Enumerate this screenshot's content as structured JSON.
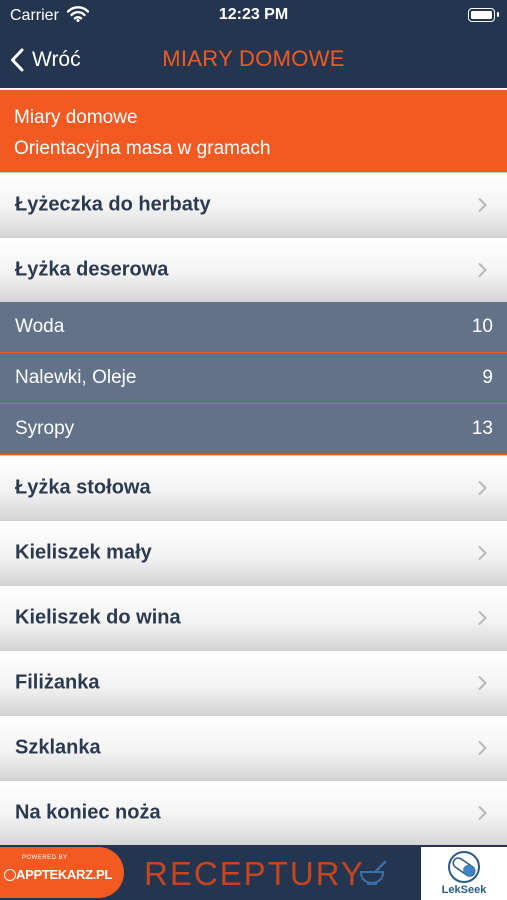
{
  "status_bar": {
    "carrier": "Carrier",
    "time": "12:23 PM",
    "icons": [
      "wifi-icon",
      "battery-icon"
    ]
  },
  "nav": {
    "back_label": "Wróć",
    "title": "MIARY DOMOWE"
  },
  "header": {
    "line1": "Miary domowe",
    "line2": "Orientacyjna masa w gramach"
  },
  "list": {
    "item_0": "Łyżeczka do herbaty",
    "item_1": "Łyżka deserowa",
    "expanded": [
      {
        "name": "Woda",
        "value": "10"
      },
      {
        "name": "Nalewki, Oleje",
        "value": "9"
      },
      {
        "name": "Syropy",
        "value": "13"
      }
    ],
    "item_2": "Łyżka stołowa",
    "item_3": "Kieliszek mały",
    "item_4": "Kieliszek do wina",
    "item_5": "Filiżanka",
    "item_6": "Szklanka",
    "item_7": "Na koniec noża"
  },
  "footer": {
    "powered_by": "POWERED BY",
    "apptekarz": "APPTEKARZ.PL",
    "receptury": "RECEPTURY",
    "lekseek": "LekSeek"
  },
  "colors": {
    "navy": "#24364f",
    "orange": "#f25a22",
    "slate": "#617289",
    "text_dark": "#2b3a4f"
  }
}
